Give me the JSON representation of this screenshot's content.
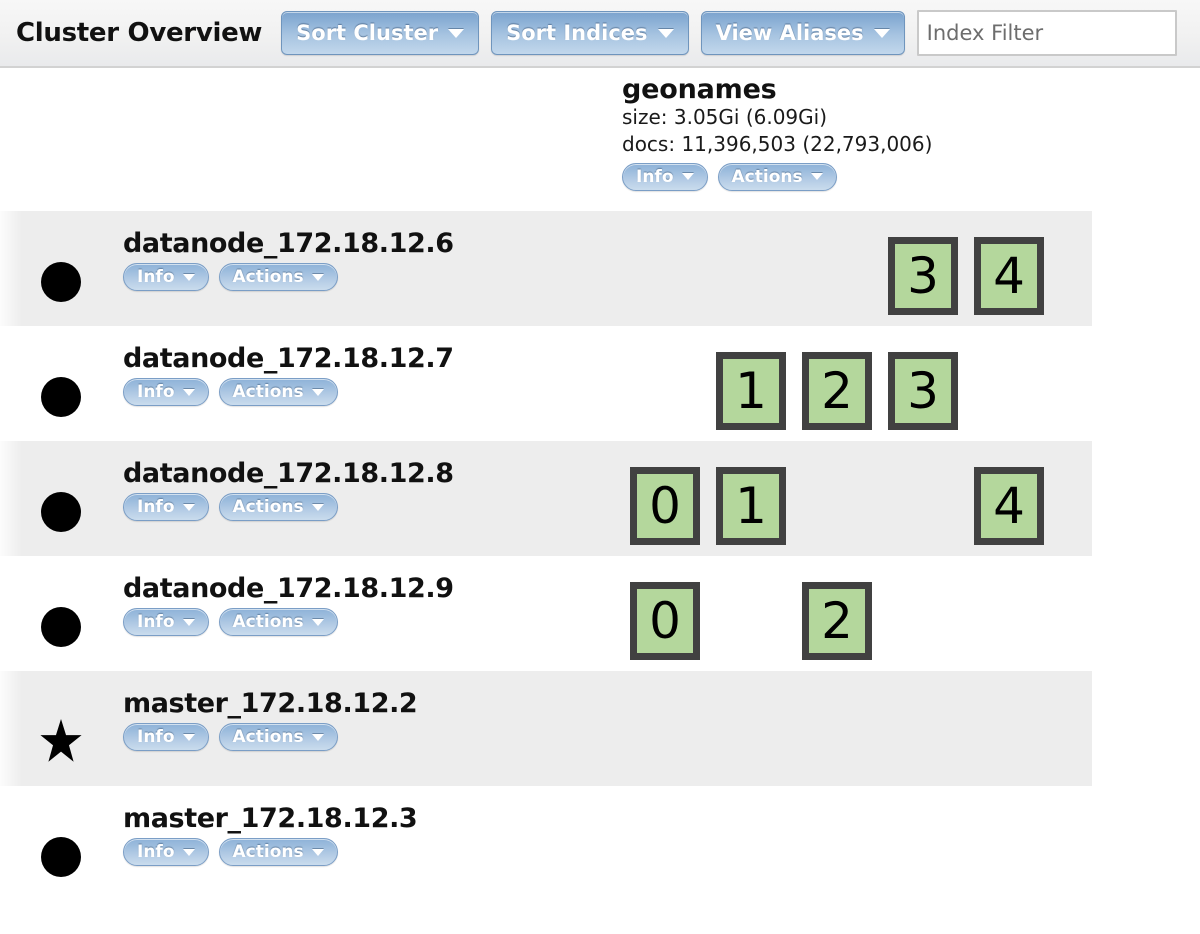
{
  "header": {
    "title": "Cluster Overview",
    "buttons": [
      {
        "label": "Sort Cluster",
        "icon": "chevron-down-icon"
      },
      {
        "label": "Sort Indices",
        "icon": "chevron-down-icon"
      },
      {
        "label": "View Aliases",
        "icon": "chevron-down-icon"
      }
    ],
    "filter": {
      "placeholder": "Index Filter",
      "value": ""
    }
  },
  "index": {
    "name": "geonames",
    "size_line": "size: 3.05Gi (6.09Gi)",
    "docs_line": "docs: 11,396,503 (22,793,006)",
    "info_label": "Info",
    "actions_label": "Actions"
  },
  "labels": {
    "info": "Info",
    "actions": "Actions"
  },
  "colors": {
    "shard_fill": "#b4d79c",
    "shard_border": "#414141",
    "button_blue": "#8cb0d6",
    "row_stripe": "#ededed"
  },
  "shard_columns": 5,
  "nodes": [
    {
      "name": "datanode_172.18.12.6",
      "marker": "circle-icon",
      "is_master_elected": false,
      "shards": [
        null,
        null,
        null,
        "3",
        "4"
      ]
    },
    {
      "name": "datanode_172.18.12.7",
      "marker": "circle-icon",
      "is_master_elected": false,
      "shards": [
        null,
        "1",
        "2",
        "3",
        null
      ]
    },
    {
      "name": "datanode_172.18.12.8",
      "marker": "circle-icon",
      "is_master_elected": false,
      "shards": [
        "0",
        "1",
        null,
        null,
        "4"
      ]
    },
    {
      "name": "datanode_172.18.12.9",
      "marker": "circle-icon",
      "is_master_elected": false,
      "shards": [
        "0",
        null,
        "2",
        null,
        null
      ]
    },
    {
      "name": "master_172.18.12.2",
      "marker": "star-icon",
      "is_master_elected": true,
      "shards": [
        null,
        null,
        null,
        null,
        null
      ]
    },
    {
      "name": "master_172.18.12.3",
      "marker": "circle-icon",
      "is_master_elected": false,
      "shards": [
        null,
        null,
        null,
        null,
        null
      ]
    }
  ]
}
